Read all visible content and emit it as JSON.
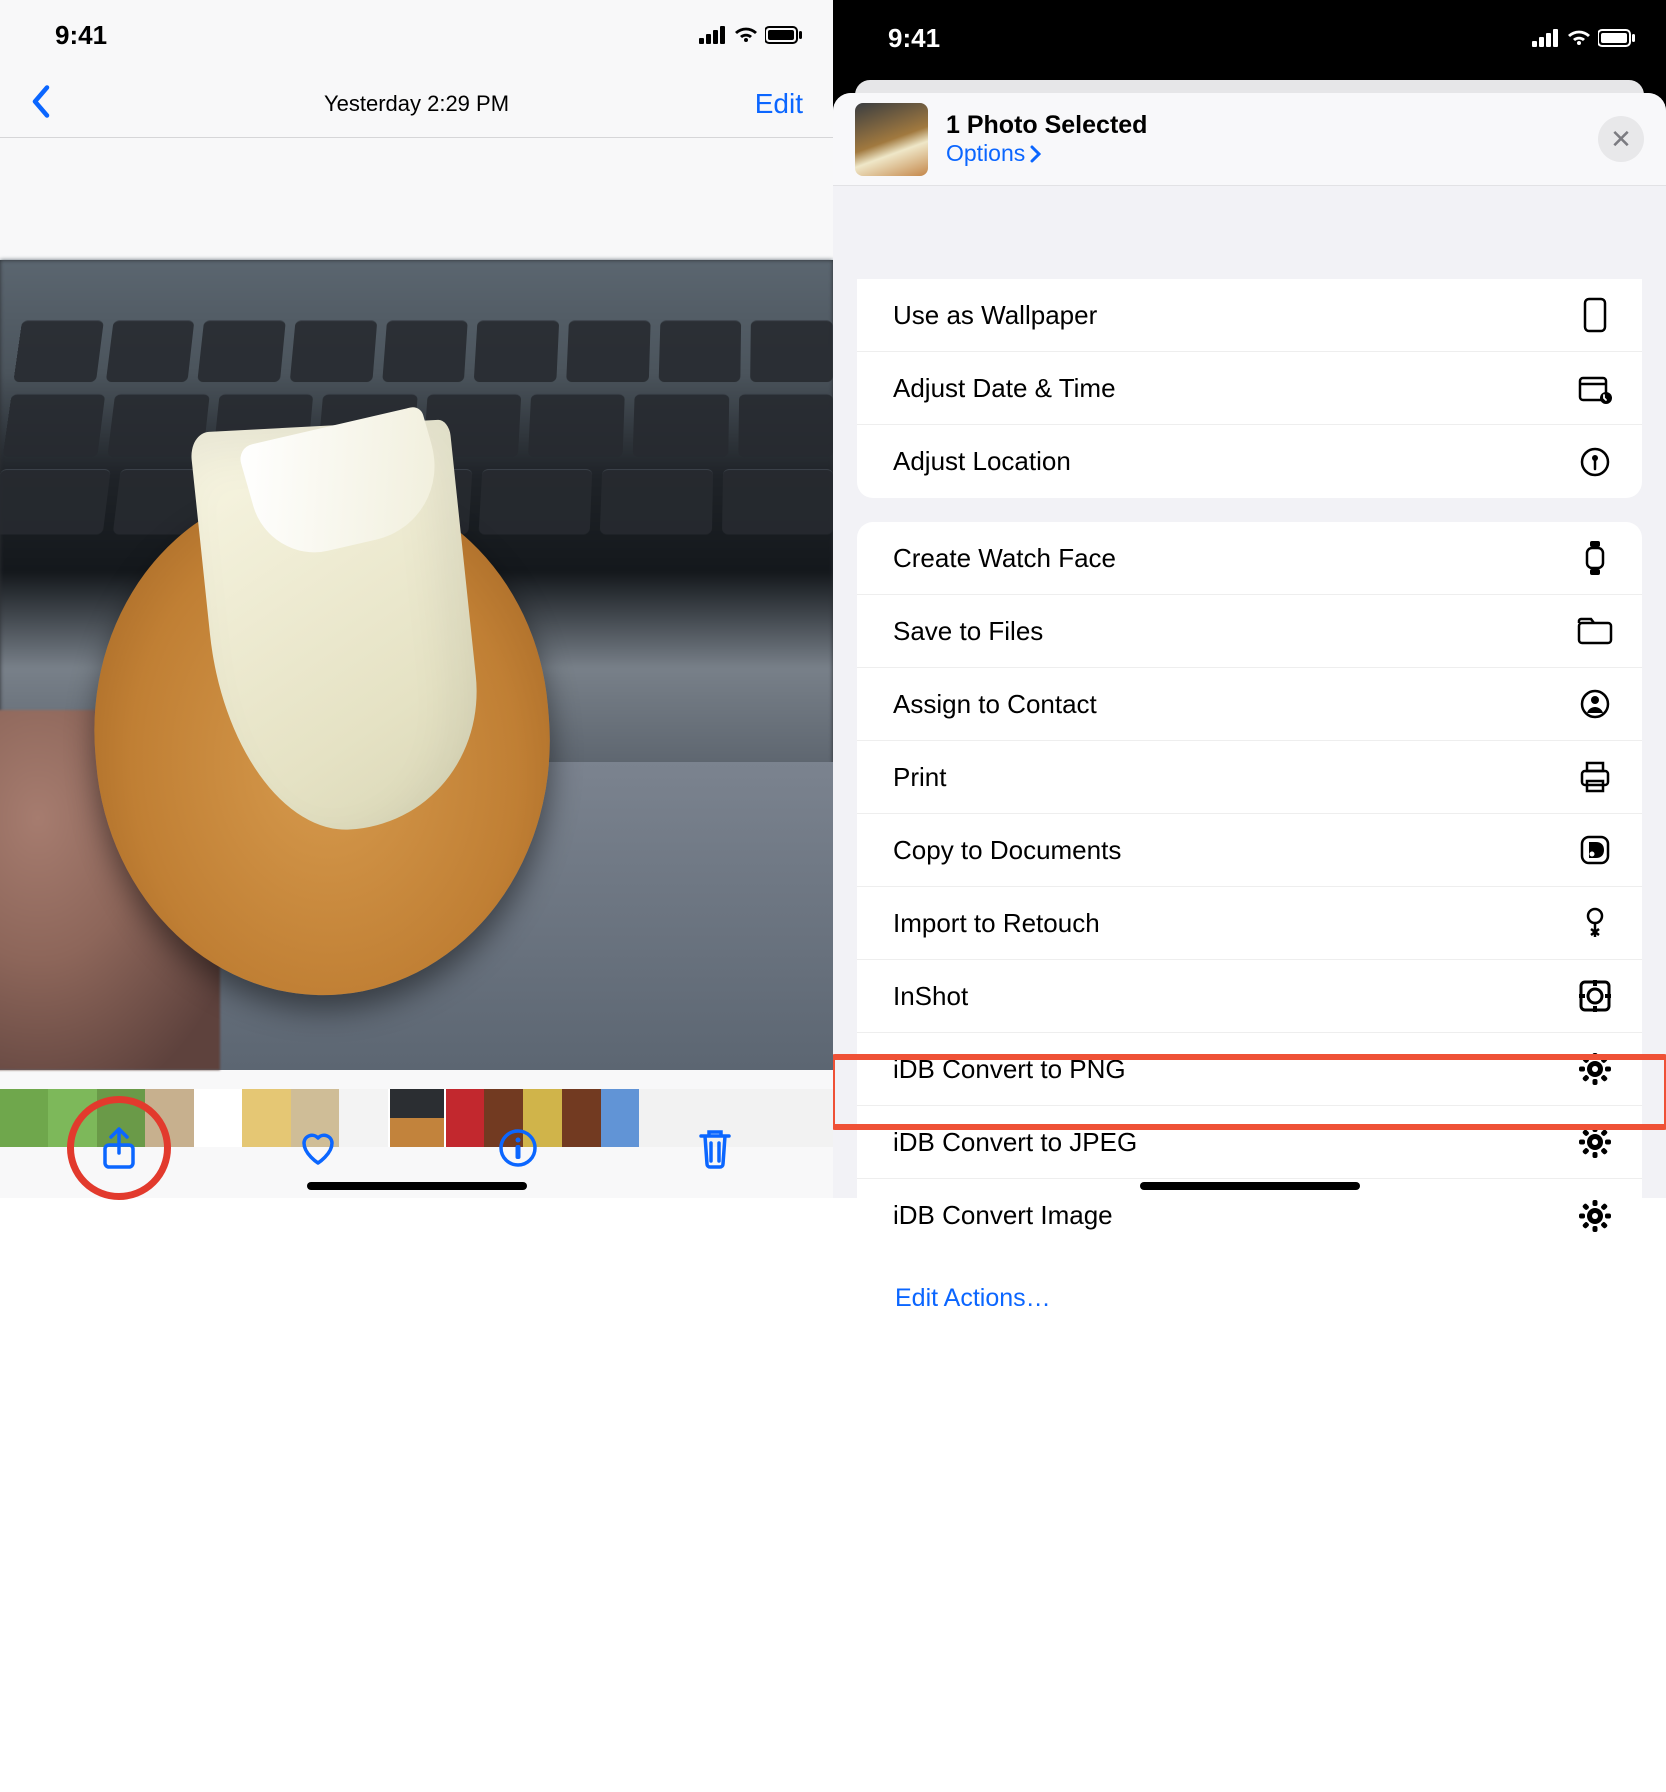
{
  "status": {
    "time": "9:41"
  },
  "left": {
    "timestamp": "Yesterday  2:29 PM",
    "edit_label": "Edit"
  },
  "share_sheet": {
    "title": "1 Photo Selected",
    "options_label": "Options",
    "close_glyph": "✕",
    "edit_actions": "Edit Actions…",
    "group1": [
      {
        "label": "Use as Wallpaper",
        "icon": "phone"
      },
      {
        "label": "Adjust Date & Time",
        "icon": "calendar"
      },
      {
        "label": "Adjust Location",
        "icon": "pin"
      }
    ],
    "group2": [
      {
        "label": "Create Watch Face",
        "icon": "watch"
      },
      {
        "label": "Save to Files",
        "icon": "folder"
      },
      {
        "label": "Assign to Contact",
        "icon": "contact"
      },
      {
        "label": "Print",
        "icon": "print"
      },
      {
        "label": "Copy to Documents",
        "icon": "doc-d"
      },
      {
        "label": "Import to Retouch",
        "icon": "retouch"
      },
      {
        "label": "InShot",
        "icon": "inshot"
      },
      {
        "label": "iDB Convert to PNG",
        "icon": "gear"
      },
      {
        "label": "iDB Convert to JPEG",
        "icon": "gear"
      },
      {
        "label": "iDB Convert Image",
        "icon": "gear"
      }
    ]
  }
}
